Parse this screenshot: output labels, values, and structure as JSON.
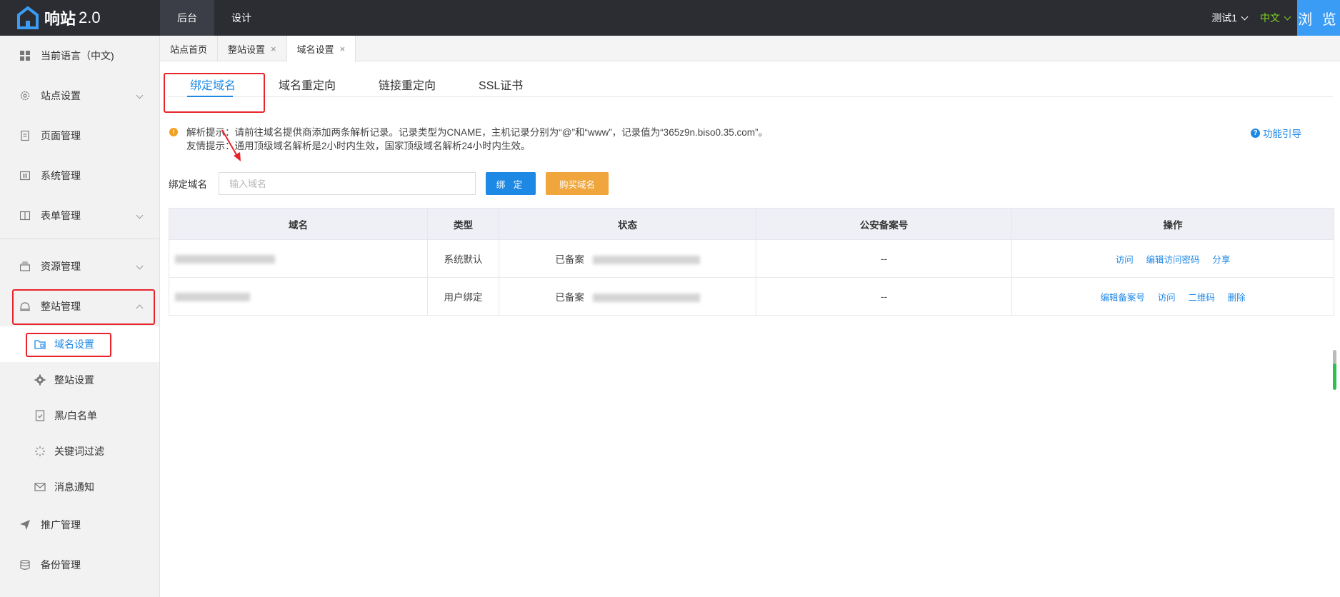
{
  "app": {
    "name": "响站",
    "version": "2.0"
  },
  "topnav": {
    "items": [
      "后台",
      "设计"
    ]
  },
  "user": {
    "name": "测试1"
  },
  "lang": {
    "current": "中文"
  },
  "browse_label": "浏 览",
  "sidebar": {
    "items": [
      {
        "label": "当前语言（中文)",
        "icon": "grid-icon"
      },
      {
        "label": "站点设置",
        "icon": "gear-icon"
      },
      {
        "label": "页面管理",
        "icon": "page-icon"
      },
      {
        "label": "系统管理",
        "icon": "system-icon"
      },
      {
        "label": "表单管理",
        "icon": "form-icon"
      },
      {
        "label": "资源管理",
        "icon": "resource-icon"
      },
      {
        "label": "整站管理",
        "icon": "site-icon"
      }
    ],
    "sub_items": [
      {
        "label": "域名设置",
        "icon": "domain-icon"
      },
      {
        "label": "整站设置",
        "icon": "cog-icon"
      },
      {
        "label": "黑/白名单",
        "icon": "list-icon"
      },
      {
        "label": "关键词过滤",
        "icon": "spinner-icon"
      },
      {
        "label": "消息通知",
        "icon": "mail-icon"
      }
    ],
    "bottom_items": [
      {
        "label": "推广管理",
        "icon": "send-icon"
      },
      {
        "label": "备份管理",
        "icon": "database-icon"
      }
    ]
  },
  "page_tabs": [
    {
      "label": "站点首页"
    },
    {
      "label": "整站设置",
      "close": "×"
    },
    {
      "label": "域名设置",
      "close": "×"
    }
  ],
  "sub_tabs": [
    "绑定域名",
    "域名重定向",
    "链接重定向",
    "SSL证书"
  ],
  "tips": {
    "line1": "解析提示：请前往域名提供商添加两条解析记录。记录类型为CNAME，主机记录分别为“@”和“www”，记录值为“365z9n.biso0.35.com”。",
    "line2": "友情提示：通用顶级域名解析是2小时内生效，国家顶级域名解析24小时内生效。"
  },
  "guide_label": "功能引导",
  "form": {
    "label": "绑定域名",
    "placeholder": "输入域名",
    "value": "",
    "bind_button": "绑 定",
    "buy_button": "购买域名"
  },
  "table": {
    "headers": [
      "域名",
      "类型",
      "状态",
      "公安备案号",
      "操作"
    ],
    "rows": [
      {
        "type": "系统默认",
        "status": "已备案",
        "police": "--",
        "ops": [
          "访问",
          "编辑访问密码",
          "分享"
        ]
      },
      {
        "type": "用户绑定",
        "status": "已备案",
        "police": "--",
        "ops": [
          "编辑备案号",
          "访问",
          "二维码",
          "删除"
        ]
      }
    ]
  },
  "colors": {
    "accent": "#1e88e5",
    "topbar": "#2b2d33",
    "highlight": "#e8232a",
    "buy": "#f0a63c"
  }
}
